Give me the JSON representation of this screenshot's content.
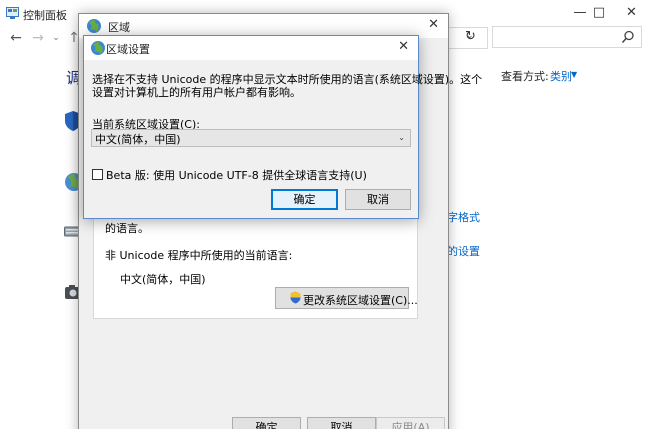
{
  "control_panel": {
    "title": "控制面板",
    "heading": "调",
    "search_placeholder": "",
    "view_by_label": "查看方式:",
    "view_by_value": "类别",
    "links": [
      "字格式",
      "的设置"
    ],
    "icons": [
      "shield-icon",
      "globe-icon",
      "keyboard-icon",
      "camera-icon"
    ]
  },
  "region_window": {
    "title": "区域",
    "panel_text_truncated": "的语言。",
    "non_unicode_label": "非 Unicode 程序中所使用的当前语言:",
    "current_language": "中文(简体，中国)",
    "change_button": "更改系统区域设置(C)...",
    "buttons": {
      "ok": "确定",
      "cancel": "取消",
      "apply": "应用(A)"
    }
  },
  "region_settings_dialog": {
    "title": "区域设置",
    "description_line1": "选择在不支持 Unicode 的程序中显示文本时所使用的语言(系统区域设置)。这个",
    "description_line2": "设置对计算机上的所有用户帐户都有影响。",
    "current_locale_label": "当前系统区域设置(C):",
    "current_locale_value": "中文(简体，中国)",
    "beta_checkbox_label": "Beta 版: 使用 Unicode UTF-8 提供全球语言支持(U)",
    "beta_checked": false,
    "ok": "确定",
    "cancel": "取消"
  }
}
